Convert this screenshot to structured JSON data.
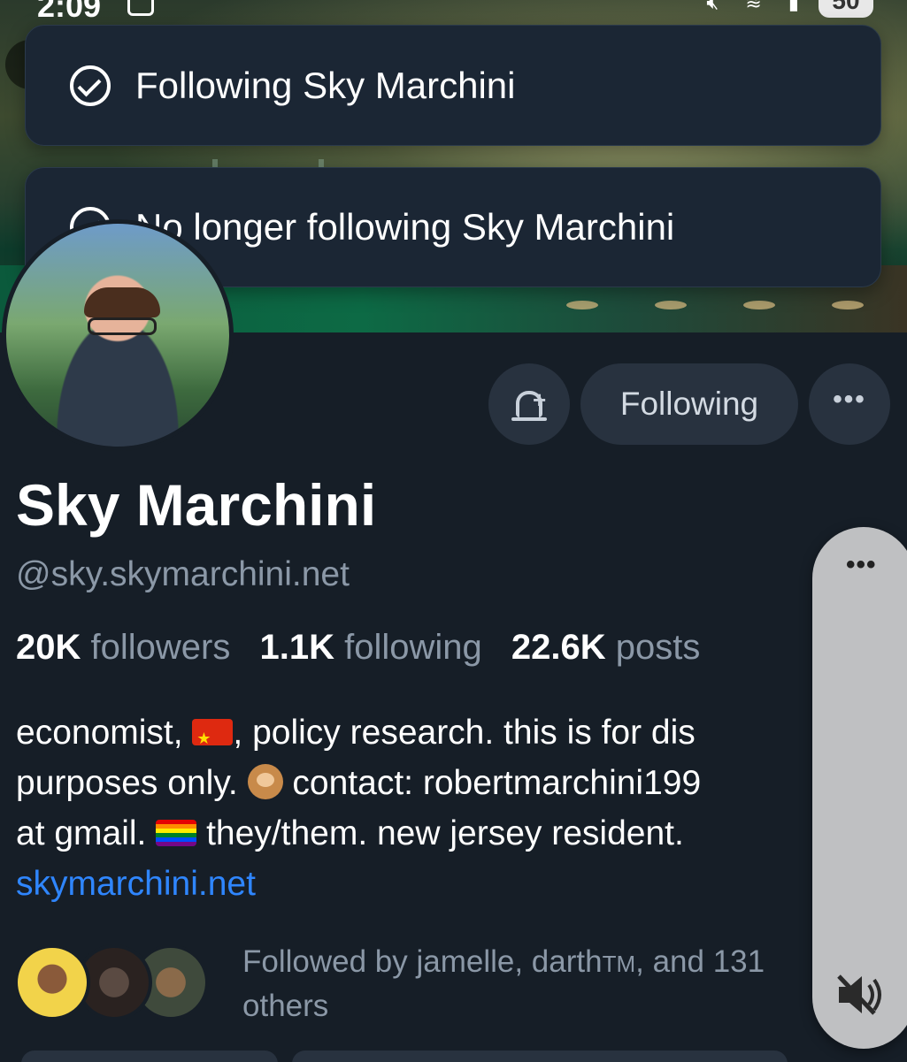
{
  "status_bar": {
    "time": "2:09",
    "battery": "50"
  },
  "toasts": [
    {
      "text": "Following Sky Marchini"
    },
    {
      "text": "No longer following Sky Marchini"
    }
  ],
  "profile": {
    "display_name": "Sky Marchini",
    "handle": "@sky.skymarchini.net",
    "stats": {
      "followers_count": "20K",
      "followers_label": "followers",
      "following_count": "1.1K",
      "following_label": "following",
      "posts_count": "22.6K",
      "posts_label": "posts"
    },
    "bio": {
      "line1_a": "economist, ",
      "line1_b": ", policy research. this is for dis",
      "line2_a": "purposes only. ",
      "line2_b": " contact: robertmarchini199",
      "line3_a": "at gmail. ",
      "line3_b": " they/them. new jersey resident.",
      "link": "skymarchini.net"
    },
    "followed_by": {
      "prefix": "Followed by jamelle, darth",
      "tm": "TM",
      "suffix": ", and 131",
      "line2": "others"
    }
  },
  "actions": {
    "following_label": "Following",
    "more_label": "•••"
  },
  "side_panel": {
    "menu_label": "•••"
  },
  "colors": {
    "background": "#161e27",
    "toast_bg": "#1b2634",
    "button_bg": "#28323f",
    "muted_text": "#8b98a7",
    "link": "#2f86ff"
  }
}
